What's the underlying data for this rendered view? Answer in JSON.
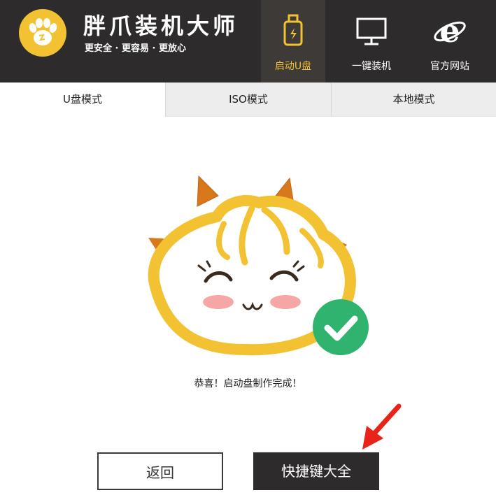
{
  "app": {
    "title": "胖爪装机大师",
    "slogan": "更安全 · 更容易 · 更放心"
  },
  "nav": [
    {
      "label": "启动U盘",
      "icon": "usb-drive-icon",
      "active": true
    },
    {
      "label": "一键装机",
      "icon": "monitor-icon",
      "active": false
    },
    {
      "label": "官方网站",
      "icon": "ie-browser-icon",
      "active": false
    }
  ],
  "tabs": [
    {
      "label": "U盘模式",
      "active": true
    },
    {
      "label": "ISO模式",
      "active": false
    },
    {
      "label": "本地模式",
      "active": false
    }
  ],
  "main": {
    "message": "恭喜！启动盘制作完成！",
    "mascot": "mascot-success-image",
    "back_label": "返回",
    "shortcuts_label": "快捷键大全"
  },
  "colors": {
    "header_bg": "#2d2b2c",
    "accent": "#f2c232",
    "success": "#2fb36e",
    "annotation_arrow": "#e8231a"
  }
}
